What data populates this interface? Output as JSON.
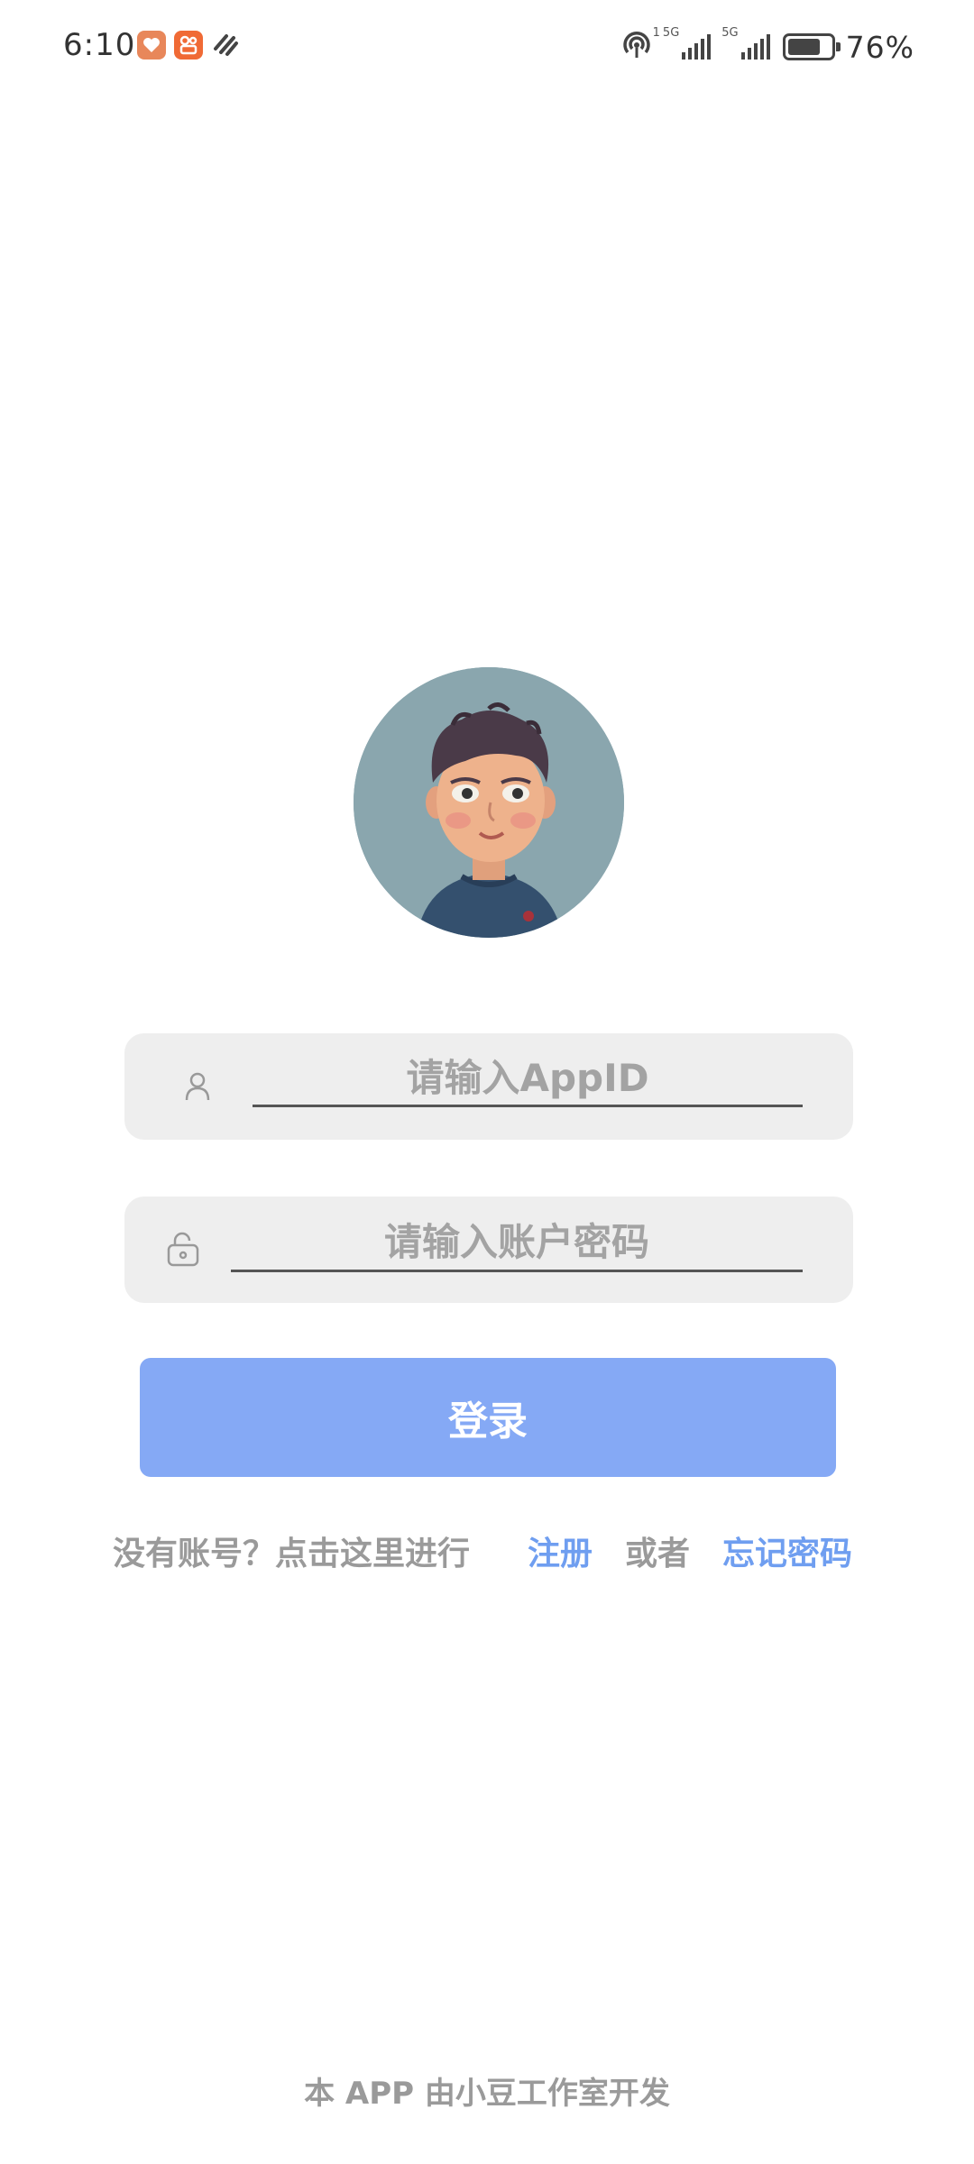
{
  "status_bar": {
    "time": "6:10",
    "network_1": "5G",
    "network_2": "5G",
    "battery_percent": 76,
    "battery_text": "76%",
    "icons": [
      "health-app-icon",
      "kuaishou-app-icon",
      "bracelet-app-icon",
      "hotspot-icon",
      "signal-icon",
      "battery-icon"
    ]
  },
  "login": {
    "appid_placeholder": "请输入AppID",
    "appid_value": "",
    "password_placeholder": "请输入账户密码",
    "password_value": "",
    "button_label": "登录"
  },
  "help": {
    "prefix": "没有账号？点击这里进行",
    "register_link": "注册",
    "or": "或者",
    "forgot_link": "忘记密码"
  },
  "footer": {
    "text": "本 APP 由小豆工作室开发"
  },
  "colors": {
    "accent": "#85a9f5",
    "link": "#6f9ef0",
    "input_bg": "#eeeeee",
    "muted_text": "#9a9a9a",
    "avatar_bg": "#8aa6ae"
  }
}
